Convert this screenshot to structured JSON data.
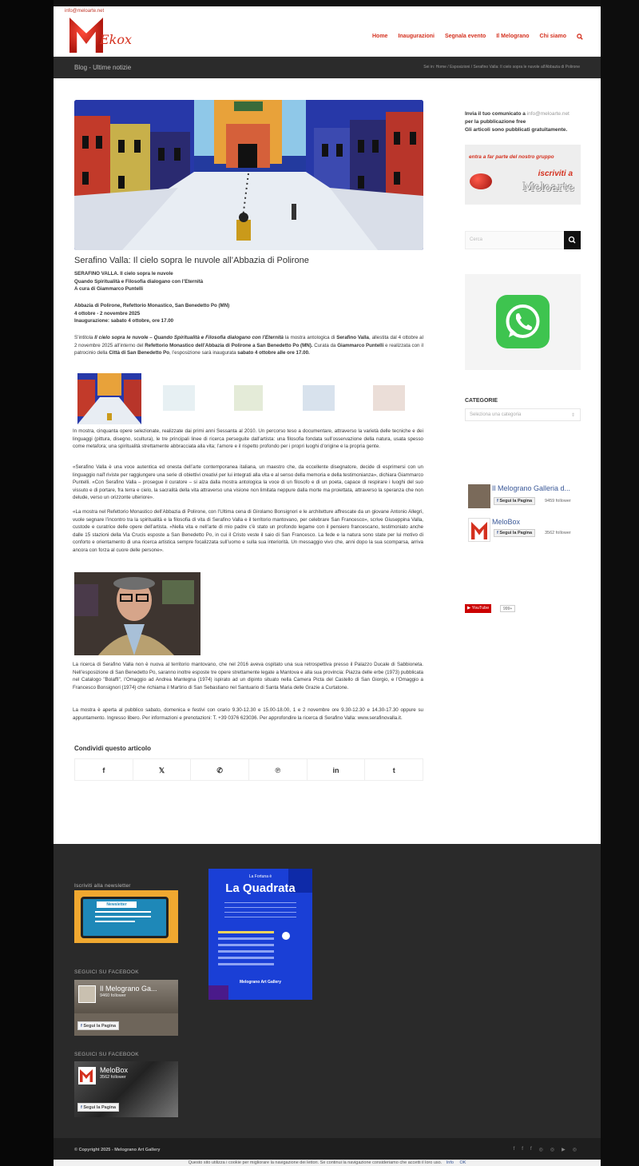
{
  "header": {
    "email": "info@meloarte.net",
    "logo_text": "Ekox",
    "nav": [
      "Home",
      "Inaugurazioni",
      "Segnala evento",
      "Il Melograno",
      "Chi siamo"
    ],
    "search_icon": "search-icon"
  },
  "titlebar": {
    "title": "Blog - Ultime notizie",
    "breadcrumb": "Sei in: Home / Esposizioni / Serafino Valla: Il cielo sopra le nuvole all'Abbazia di Polirone"
  },
  "post": {
    "title": "Serafino Valla: Il cielo sopra le nuvole all’Abbazia di Polirone",
    "head1": [
      "SERAFINO VALLA. Il cielo sopra le nuvole",
      "Quando Spiritualità e Filosofia dialogano con l’Eternità",
      "A cura di Giammarco Puntelli"
    ],
    "head2": [
      "Abbazia di Polirone, Refettorio Monastico, San Benedetto Po (MN)",
      "4 ottobre - 2 novembre 2025",
      "Inaugurazione: sabato 4 ottobre, ore 17.00"
    ],
    "p1_a": "S’intitola ",
    "p1_b": "Il cielo sopra le nuvole – Quando Spiritualità e Filosofia dialogano con l’Eternità",
    "p1_c": " la mostra antologica di ",
    "p1_d": "Serafino Valla",
    "p1_e": ", allestita dal 4 ottobre al 2 novembre 2025 all’interno del ",
    "p1_f": "Refettorio Monastico dell’Abbazia di Polirone a San Benedetto Po (MN).",
    "p1_g": " Curata da ",
    "p1_h": "Giammarco Puntelli",
    "p1_i": " e realizzata con il patrocinio della ",
    "p1_j": "Città di San Benedetto Po",
    "p1_k": ", l’esposizione sarà inaugurata ",
    "p1_l": "sabato 4 ottobre alle ore 17.00.",
    "p2": "In mostra, cinquanta opere selezionate, realizzate dai primi anni Sessanta al 2010. Un percorso teso a documentare, attraverso la varietà delle tecniche e dei linguaggi (pittura, disegno, scultura), le tre principali linee di ricerca perseguite dall’artista: una filosofia fondata sull’osservazione della natura, usata spesso come metafora; una spiritualità strettamente abbracciata alla vita; l’amore e il rispetto profondo per i propri luoghi d’origine e la propria gente.",
    "p3": "«Serafino Valla è una voce autentica ed onesta dell’arte contemporanea italiana, un maestro che, da eccellente disegnatore, decide di esprimersi con un linguaggio naïf riviste per raggiungere una serie di obiettivi creativi per lui integrati alla vita e al senso della memoria e della testimonianza», dichiara Giammarco Puntelli. «Con Serafino Valla – prosegue il curatore – si alza dalla mostra antologica la voce di un filosofo e di un poeta, capace di respirare i luoghi del suo vissuto e di portare, fra terra e cielo, la sacralità della vita attraverso una visione non limitata neppure dalla morte ma proiettata, attraverso la speranza che non delude, verso un orizzonte ulteriore».",
    "p4": "«La mostra nel Refettorio Monastico dell’Abbazia di Polirone, con l’Ultima cena di Girolamo Bonsignori e le architetture affrescate da un giovane Antonio Allegri, vuole segnare l’incontro tra la spiritualità e la filosofia di vita di Serafino Valla e il territorio mantovano, per celebrare San Francesco», scrive Giuseppina Valla, custode e curatrice delle opere dell’artista. «Nella vita e nell’arte di mio padre c’è stato un profondo legame con il pensiero francescano, testimoniato anche dalle 15 stazioni della Via Crucis esposte a San Benedetto Po, in cui il Cristo veste il saio di San Francesco. La fede e la natura sono state per lui motivo di conforto e orientamento di una ricerca artistica sempre focalizzata sull’uomo e sulla sua interiorità. Un messaggio vivo che, anni dopo la sua scomparsa, arriva ancora con forza al cuore delle persone».",
    "p5": "La ricerca di Serafino Valla non è nuova al territorio mantovano, che nel 2016 aveva ospitato una sua retrospettiva presso il Palazzo Ducale di Sabbioneta. Nell’esposizione di San Benedetto Po, saranno inoltre esposte tre opere strettamente legate a Mantova e alla sua provincia: Piazza delle erbe (1973) pubblicata nel Catalogo \"Bolaffi\", l’Omaggio ad Andrea Mantegna (1974) ispirato ad un dipinto situato nella Camera Picta del Castello di San Giorgio, e l’Omaggio a Francesco Bonsignori (1974) che richiama il Martirio di San Sebastiano nel Santuario di Santa Maria delle Grazie a Curtatone.",
    "p6": "La mostra è aperta al pubblico sabato, domenica e festivi con orario 9.30-12.30 e 15.00-18.00, 1 e 2 novembre ore 9.30-12.30 e 14.30-17.30 oppure su appuntamento. Ingresso libero. Per informazioni e prenotazioni: T. +39 0376 623036. Per approfondire la ricerca di Serafino Valla: www.serafinovalla.it.",
    "share_title": "Condividi questo articolo",
    "share_icons": [
      "f",
      "𝕏",
      "✆",
      "℗",
      "in",
      "t"
    ]
  },
  "sidebar": {
    "invia_a": "Invia il tuo comunicato a ",
    "invia_email": "info@meloarte.net",
    "invia_b": "per la pubblicazione free",
    "invia_c": "Gli articoli sono pubblicati gratuitamente.",
    "banner_top": "entra a far parte del nostro gruppo",
    "banner_iscriviti": "iscriviti a",
    "banner_brand": "Meloarte",
    "search_placeholder": "Cerca",
    "categorie_title": "CATEGORIE",
    "categorie_select": "Seleziona una categoria",
    "fb1_name": "Il Melograno Galleria d...",
    "fb1_btn": "Segui la Pagina",
    "fb1_count": "9459 follower",
    "fb2_name": "MeloBox",
    "fb2_btn": "Segui la Pagina",
    "fb2_count": "3562 follower",
    "yt_label": "YouTube",
    "yt_count": "999+"
  },
  "footer": {
    "newsletter_title": "Iscriviti alla newsletter",
    "newsletter_img": "Newsletter",
    "fb_title1": "SEGUICI SU FACEBOOK",
    "fb_title2": "SEGUICI SU FACEBOOK",
    "fbw1_name": "Il Melograno Ga...",
    "fbw1_count": "9460 follower",
    "fbw1_btn": "Segui la Pagina",
    "fbw2_name": "MeloBox",
    "fbw2_count": "3562 follower",
    "fbw2_btn": "Segui la Pagina",
    "quadrata_small": "La Fortuna è",
    "quadrata_title": "La Quadrata",
    "quadrata_foot": "Melograno Art Gallery",
    "copyright": "© Copyright 2025 - Melograno Art Gallery",
    "social_icons": [
      "f",
      "f",
      "f",
      "◎",
      "◎",
      "▶",
      "◎"
    ]
  },
  "cookie": {
    "text": "Questo sito utilizza i cookie per migliorare la navigazione dei lettori. Se continui la navigazione consideriamo che accetti il loro uso.",
    "info": "Info",
    "ok": "OK"
  },
  "colors": {
    "accent": "#d4301e",
    "dark": "#2b2b2b",
    "footer": "#2a2a2a",
    "fb": "#3b5998",
    "wa": "#3ec44f"
  }
}
